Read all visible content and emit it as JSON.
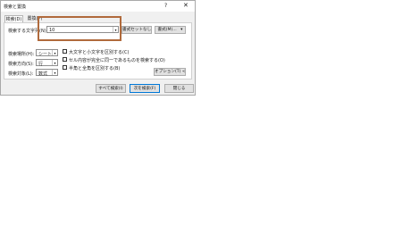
{
  "dialog": {
    "title": "検索と置換",
    "help_label": "?",
    "close_label": "✕"
  },
  "tabs": [
    {
      "label": "検索(D)",
      "selected": true
    },
    {
      "label": "置換(P)",
      "selected": false
    }
  ],
  "search": {
    "label": "検索する文字列(N):",
    "value": "10",
    "format_status": "書式セットなし",
    "format_button": "書式(M)...",
    "format_dropdown": "▾"
  },
  "options": {
    "scope_label": "検索場所(H):",
    "scope_value": "シート",
    "direction_label": "検索方向(S):",
    "direction_value": "行",
    "lookin_label": "検索対象(L):",
    "lookin_value": "数式",
    "match_case_label": "大文字と小文字を区別する(C)",
    "match_entire_label": "セル内容が完全に同一であるものを検索する(O)",
    "match_byte_label": "半角と全角を区別する(B)",
    "options_button": "オプション(T) <<"
  },
  "footer": {
    "find_all": "すべて検索(I)",
    "find_next": "次を検索(F)",
    "close": "閉じる"
  },
  "colors": {
    "highlight": "#b06a3c"
  }
}
